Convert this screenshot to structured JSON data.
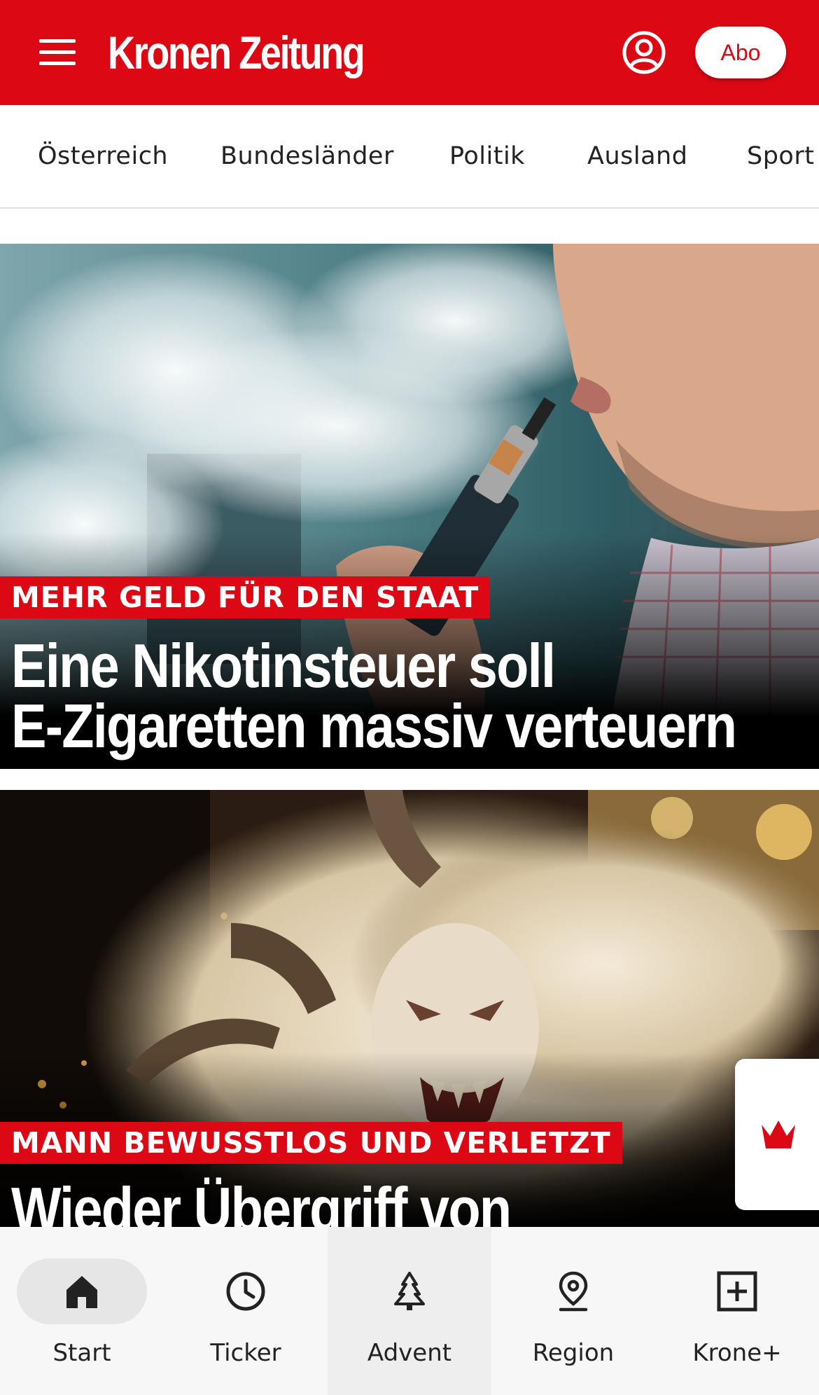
{
  "header": {
    "logo_text": "Kronen Zeitung",
    "abo_label": "Abo",
    "menu_icon": "hamburger-menu-icon",
    "account_icon": "user-account-icon",
    "brand_color": "#dc0814"
  },
  "categories": [
    {
      "label": "Österreich"
    },
    {
      "label": "Bundesländer"
    },
    {
      "label": "Politik"
    },
    {
      "label": "Ausland"
    },
    {
      "label": "Sport"
    }
  ],
  "articles": [
    {
      "kicker": "MEHR GELD FÜR DEN STAAT",
      "headline_line1": "Eine Nikotinsteuer soll",
      "headline_line2": "E-Zigaretten massiv verteuern"
    },
    {
      "kicker": "MANN BEWUSSTLOS UND VERLETZT",
      "headline_line1": "Wieder Übergriff von"
    }
  ],
  "floating_button": {
    "icon": "krone-crown-icon"
  },
  "bottom_nav": {
    "items": [
      {
        "label": "Start",
        "icon": "home-icon",
        "active": true
      },
      {
        "label": "Ticker",
        "icon": "clock-icon",
        "active": false
      },
      {
        "label": "Advent",
        "icon": "christmas-tree-icon",
        "active": false
      },
      {
        "label": "Region",
        "icon": "location-pin-icon",
        "active": false
      },
      {
        "label": "Krone+",
        "icon": "plus-box-icon",
        "active": false
      }
    ]
  }
}
